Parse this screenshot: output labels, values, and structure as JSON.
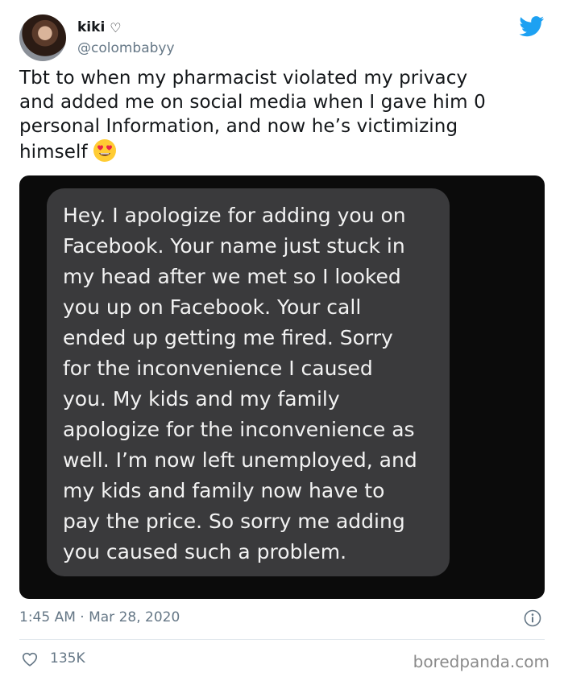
{
  "author": {
    "display_name": "kiki",
    "name_badge": "♡",
    "handle": "@colombabyy"
  },
  "tweet": {
    "text": "Tbt to when my pharmacist violated my privacy and added me on social media when I gave him 0 personal Information, and now he’s victimizing himself",
    "lines": [
      "Tbt to when my pharmacist violated my privacy",
      "and added me on social media when I gave him 0",
      "personal Information, and now he’s victimizing",
      "himself"
    ],
    "emoji": "heart-eyes-emoji"
  },
  "media": {
    "message_lines": [
      "Hey. I apologize for adding you on",
      "Facebook. Your name just stuck in",
      "my head after we met so I looked",
      "you up on Facebook. Your call",
      "ended up getting me fired. Sorry",
      "for the inconvenience I caused",
      "you. My kids and my family",
      "apologize for the inconvenience as",
      "well. I’m now left unemployed, and",
      "my kids and family now have to",
      "pay the price. So sorry me adding",
      "you caused such a problem."
    ]
  },
  "footer": {
    "timestamp": "1:45 AM · Mar 28, 2020",
    "likes": "135K",
    "watermark": "boredpanda.com"
  },
  "colors": {
    "twitter_blue": "#1da1f2",
    "secondary_text": "#657786",
    "bubble": "#3a3a3c"
  },
  "icons": [
    "twitter-bird-icon",
    "info-icon",
    "heart-icon"
  ]
}
